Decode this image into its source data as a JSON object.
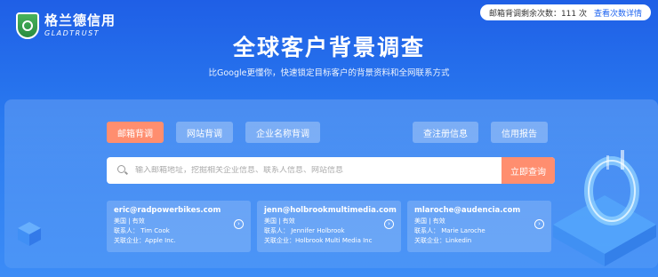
{
  "brand": {
    "name_cn": "格兰德信用",
    "name_en": "GLADTRUST",
    "logo_icon": "shield-98-icon"
  },
  "quota": {
    "text": "邮箱背调剩余次数：111 次",
    "detail_link": "查看次数详情"
  },
  "hero": {
    "title": "全球客户背景调查",
    "subtitle": "比Google更懂你，快速锁定目标客户的背景资料和全网联系方式"
  },
  "tabs": [
    {
      "label": "邮箱背调",
      "active": true
    },
    {
      "label": "网站背调",
      "active": false
    },
    {
      "label": "企业名称背调",
      "active": false
    }
  ],
  "right_buttons": [
    {
      "label": "查注册信息"
    },
    {
      "label": "信用报告"
    }
  ],
  "search": {
    "placeholder": "输入邮箱地址，挖掘相关企业信息、联系人信息、网站信息",
    "button_label": "立即查询"
  },
  "cards": [
    {
      "email": "eric@radpowerbikes.com",
      "region_status": "美国 | 有效",
      "contact": "联系人：  Tim Cook",
      "company": "关联企业：Apple Inc."
    },
    {
      "email": "jenn@holbrookmultimedia.com",
      "region_status": "美国 | 有效",
      "contact": "联系人：  Jennifer Holbrook",
      "company": "关联企业：Holbrook Multi Media Inc"
    },
    {
      "email": "mlaroche@audencia.com",
      "region_status": "美国 | 有效",
      "contact": "联系人：  Marie Laroche",
      "company": "关联企业：Linkedin"
    }
  ],
  "colors": {
    "accent": "#ff8e6f",
    "primary": "#2a7bf0",
    "link": "#1e64f0"
  }
}
